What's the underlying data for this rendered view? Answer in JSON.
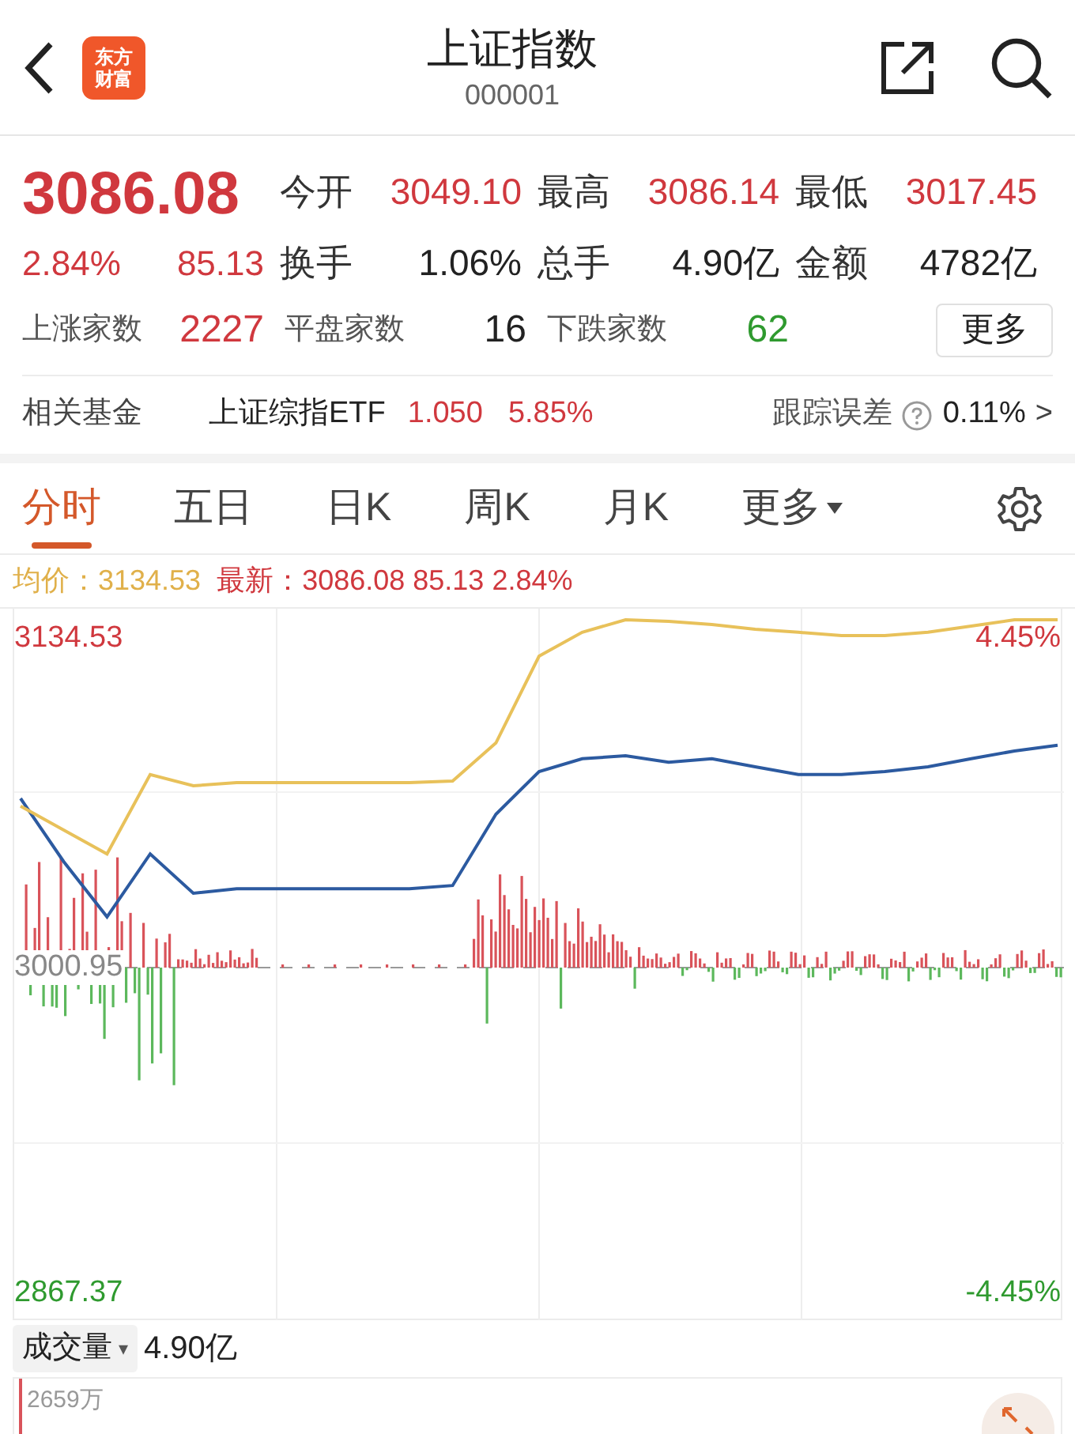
{
  "header": {
    "title": "上证指数",
    "code": "000001",
    "logo_lines": [
      "东方",
      "财富"
    ]
  },
  "quote": {
    "price": "3086.08",
    "change_pct": "2.84%",
    "change": "85.13",
    "stats": [
      {
        "label": "今开",
        "value": "3049.10",
        "color": "#d0383e"
      },
      {
        "label": "最高",
        "value": "3086.14",
        "color": "#d0383e"
      },
      {
        "label": "最低",
        "value": "3017.45",
        "color": "#d0383e"
      },
      {
        "label": "换手",
        "value": "1.06%",
        "color": "#222222"
      },
      {
        "label": "总手",
        "value": "4.90亿",
        "color": "#222222"
      },
      {
        "label": "金额",
        "value": "4782亿",
        "color": "#222222"
      }
    ],
    "breadth": [
      {
        "label": "上涨家数",
        "value": "2227",
        "color": "#d0383e"
      },
      {
        "label": "平盘家数",
        "value": "16",
        "color": "#222222"
      },
      {
        "label": "下跌家数",
        "value": "62",
        "color": "#2f9a2f"
      }
    ],
    "more_button": "更多"
  },
  "fund": {
    "label": "相关基金",
    "name": "上证综指ETF",
    "price": "1.050",
    "change": "5.85%",
    "tracking_label": "跟踪误差",
    "tracking_value": "0.11%",
    "chevron": ">"
  },
  "tabs": [
    {
      "label": "分时",
      "selected": true,
      "kind": "plain"
    },
    {
      "label": "五日",
      "selected": false,
      "kind": "plain"
    },
    {
      "label": "日K",
      "selected": false,
      "kind": "plain"
    },
    {
      "label": "周K",
      "selected": false,
      "kind": "plain"
    },
    {
      "label": "月K",
      "selected": false,
      "kind": "plain"
    },
    {
      "label": "更多",
      "selected": false,
      "kind": "dropdown"
    }
  ],
  "legend": {
    "avg_label": "均价：",
    "avg_value": "3134.53",
    "latest_label": "最新：",
    "latest_values": [
      "3086.08",
      "85.13",
      "2.84%"
    ]
  },
  "left_labels": [
    "3134.53",
    "3000.95",
    "2867.37"
  ],
  "right_labels": [
    "4.45%",
    "-4.45%"
  ],
  "volume": {
    "selector": "成交量",
    "caret": "▾",
    "value": "4.90亿",
    "axis_label": "2659万"
  }
}
